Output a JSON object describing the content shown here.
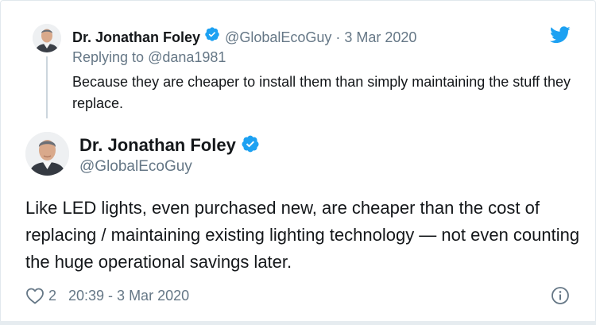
{
  "reply_tweet": {
    "author_name": "Dr. Jonathan Foley",
    "handle": "@GlobalEcoGuy",
    "separator": "·",
    "date": "3 Mar 2020",
    "replying_to_label": "Replying to",
    "replying_to_handle": "@dana1981",
    "text": "Because they are cheaper to install them than simply maintaining the stuff they replace."
  },
  "main_tweet": {
    "author_name": "Dr. Jonathan Foley",
    "handle": "@GlobalEcoGuy",
    "text": "Like LED lights, even purchased new, are cheaper than the cost of replacing / maintaining existing lighting technology — not even counting the huge operational savings later.",
    "like_count": "2",
    "timestamp": "20:39 - 3 Mar 2020"
  },
  "icons": {
    "verified": "verified-badge-icon",
    "twitter": "twitter-bird-icon",
    "like": "heart-icon",
    "info": "info-icon"
  },
  "colors": {
    "twitter_blue": "#1da1f2",
    "secondary_text": "#657786",
    "primary_text": "#14171a",
    "border": "#e1e8ed"
  }
}
